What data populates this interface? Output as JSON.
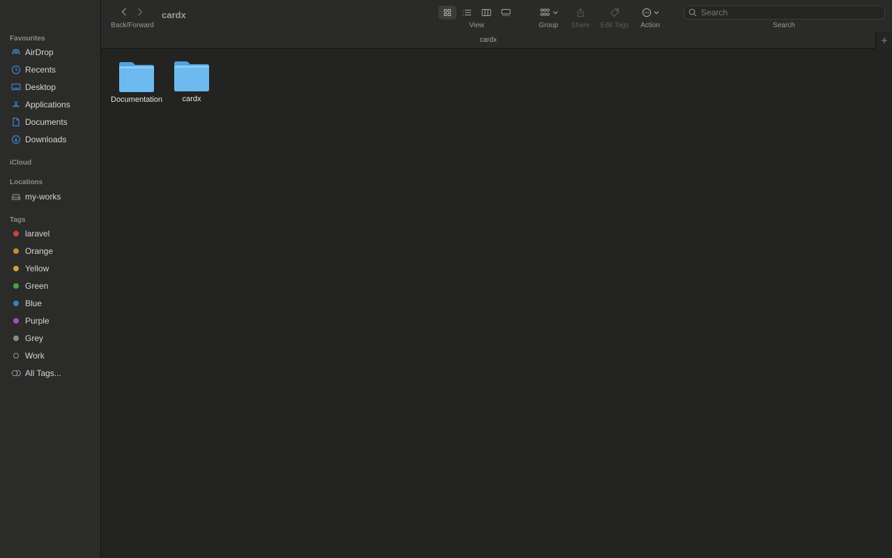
{
  "window": {
    "title": "cardx"
  },
  "toolbar": {
    "nav_label": "Back/Forward",
    "view_label": "View",
    "group_label": "Group",
    "share_label": "Share",
    "edit_tags_label": "Edit Tags",
    "action_label": "Action",
    "search_label": "Search",
    "search_placeholder": "Search",
    "active_view": "icon"
  },
  "pathbar": {
    "title": "cardx"
  },
  "sidebar": {
    "favourites_heading": "Favourites",
    "favourites": [
      {
        "label": "AirDrop",
        "icon": "airdrop-icon"
      },
      {
        "label": "Recents",
        "icon": "clock-icon"
      },
      {
        "label": "Desktop",
        "icon": "desktop-icon"
      },
      {
        "label": "Applications",
        "icon": "applications-icon"
      },
      {
        "label": "Documents",
        "icon": "document-icon"
      },
      {
        "label": "Downloads",
        "icon": "download-icon"
      }
    ],
    "icloud_heading": "iCloud",
    "locations_heading": "Locations",
    "locations": [
      {
        "label": "my-works",
        "icon": "disk-icon"
      }
    ],
    "tags_heading": "Tags",
    "tags": [
      {
        "label": "laravel",
        "color": "#c9453f"
      },
      {
        "label": "Orange",
        "color": "#c98a2e"
      },
      {
        "label": "Yellow",
        "color": "#c2a83a"
      },
      {
        "label": "Green",
        "color": "#47a348"
      },
      {
        "label": "Blue",
        "color": "#3c7fc4"
      },
      {
        "label": "Purple",
        "color": "#9a55b3"
      },
      {
        "label": "Grey",
        "color": "#8a8a8a"
      },
      {
        "label": "Work",
        "color": ""
      },
      {
        "label": "All Tags...",
        "color": ""
      }
    ]
  },
  "content": {
    "items": [
      {
        "name": "Documentation",
        "type": "folder"
      },
      {
        "name": "cardx",
        "type": "folder"
      }
    ]
  },
  "colors": {
    "accent": "#3a87d6",
    "folder_front": "#6cbaf0",
    "folder_back": "#4fa2e0"
  }
}
